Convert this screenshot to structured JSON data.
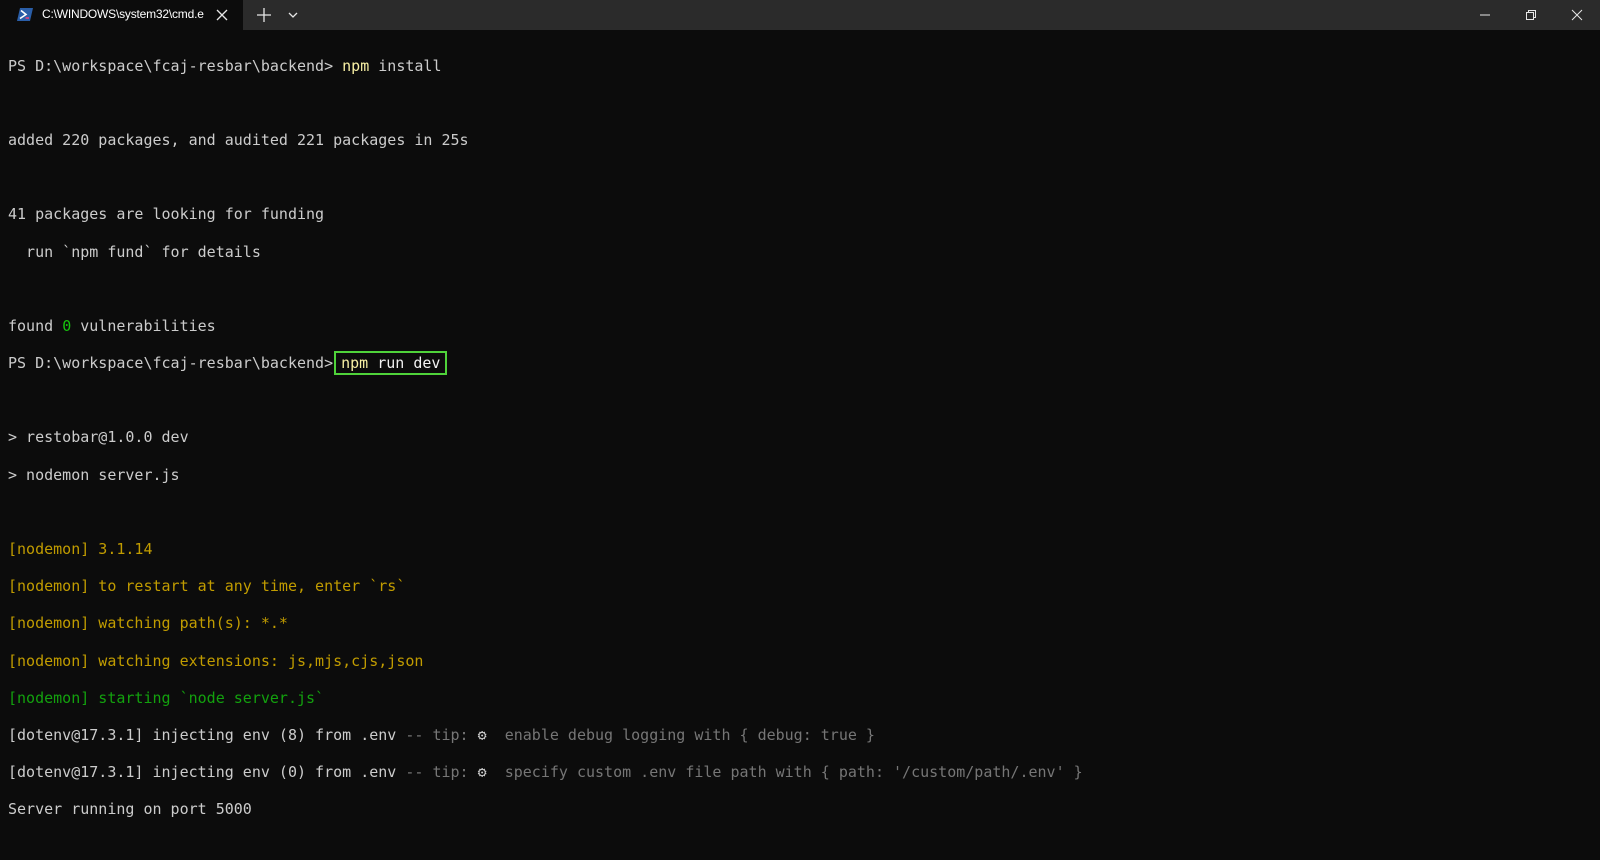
{
  "window": {
    "tab_title": "C:\\WINDOWS\\system32\\cmd.e",
    "tab_icon": "powershell-icon",
    "new_tab_icon": "plus-icon",
    "dropdown_icon": "chevron-down-icon"
  },
  "colors": {
    "background": "#0c0c0c",
    "titlebar": "#2b2b2b",
    "highlight_box": "#4fd33a",
    "nodemon_yellow": "#c19c00",
    "nodemon_green": "#13a10e"
  },
  "terminal": {
    "prompt1": "PS D:\\workspace\\fcaj-resbar\\backend>",
    "cmd1_npm": "npm",
    "cmd1_rest": " install",
    "added_line": "added 220 packages, and audited 221 packages in 25s",
    "funding_line": "41 packages are looking for funding",
    "fund_hint": "  run `npm fund` for details",
    "found_prefix": "found ",
    "found_count": "0",
    "found_suffix": " vulnerabilities",
    "prompt2": "PS D:\\workspace\\fcaj-resbar\\backend>",
    "cmd2_npm": "npm",
    "cmd2_rest": " run dev",
    "script_line1": "> restobar@1.0.0 dev",
    "script_line2": "> nodemon server.js",
    "nodemon1": "[nodemon] 3.1.14",
    "nodemon2": "[nodemon] to restart at any time, enter `rs`",
    "nodemon3": "[nodemon] watching path(s): *.*",
    "nodemon4": "[nodemon] watching extensions: js,mjs,cjs,json",
    "nodemon5": "[nodemon] starting `node server.js`",
    "dotenv1_main": "[dotenv@17.3.1] injecting env (8) from .env",
    "dotenv1_tip": " -- tip: ",
    "dotenv1_gear": "⚙",
    "dotenv1_msg": "  enable debug logging with { debug: true }",
    "dotenv2_main": "[dotenv@17.3.1] injecting env (0) from .env",
    "dotenv2_tip": " -- tip: ",
    "dotenv2_gear": "⚙",
    "dotenv2_msg": "  specify custom .env file path with { path: '/custom/path/.env' }",
    "server_line": "Server running on port 5000"
  }
}
